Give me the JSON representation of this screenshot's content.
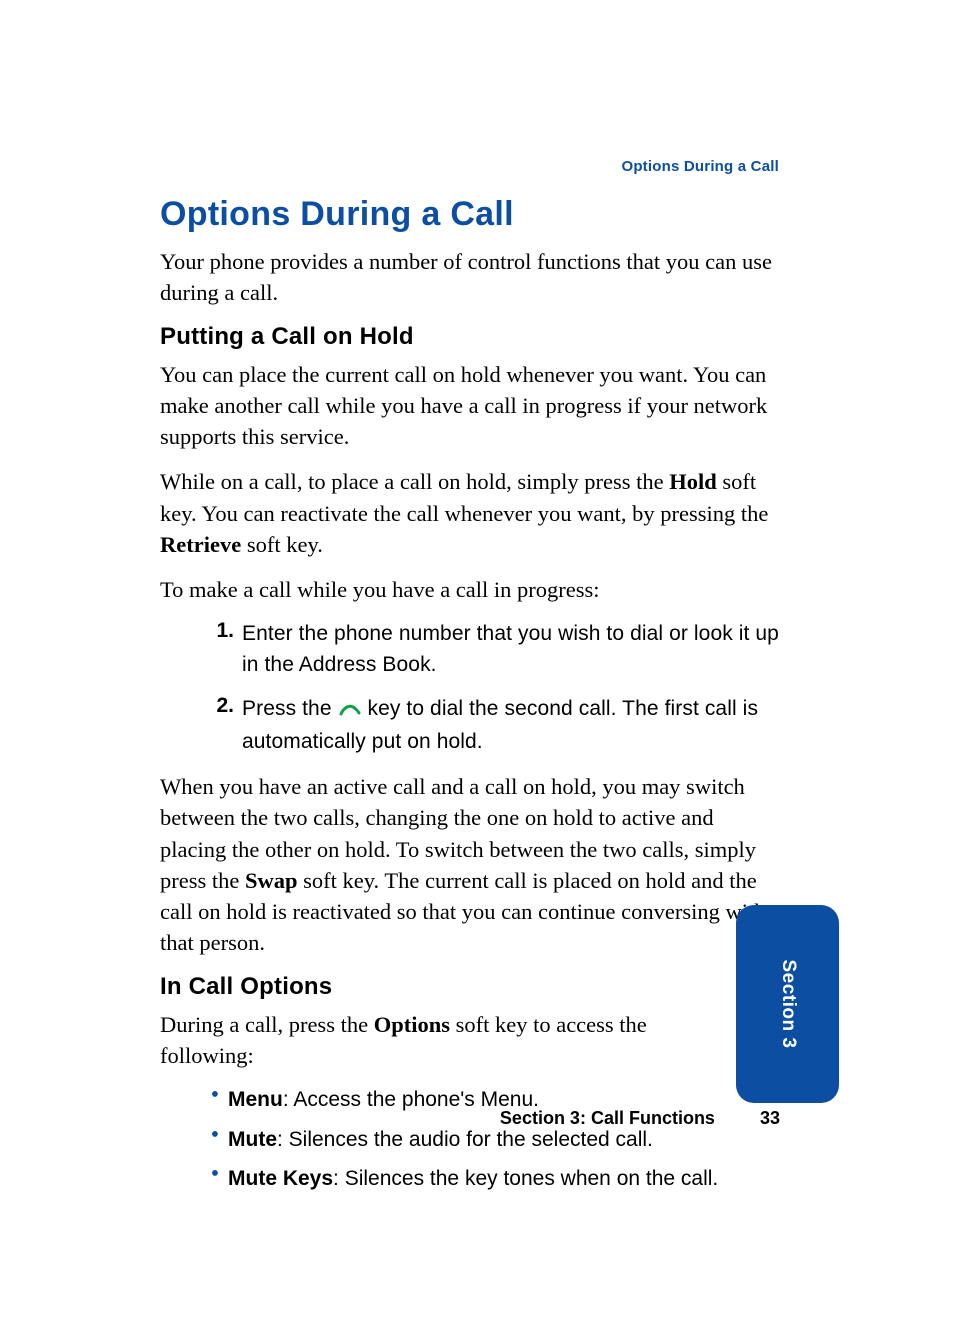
{
  "runningHeader": "Options During a Call",
  "title": "Options During a Call",
  "intro": "Your phone provides a number of control functions that you can use during a call.",
  "hold": {
    "heading": "Putting a Call on Hold",
    "p1": "You can place the current call on hold whenever you want. You can make another call while you have a call in progress if your network supports this service.",
    "p2_a": "While on a call, to place a call on hold, simply press the ",
    "p2_bold1": "Hold",
    "p2_b": " soft key. You can reactivate the call whenever you want, by pressing the ",
    "p2_bold2": "Retrieve",
    "p2_c": " soft key.",
    "p3": "To make a call while you have a call in progress:",
    "steps": [
      {
        "num": "1.",
        "text": "Enter the phone number that you wish to dial or look it up in the Address Book."
      },
      {
        "num": "2.",
        "text_a": "Press the ",
        "text_b": " key to dial the second call. The first call is automatically put on hold."
      }
    ],
    "p4_a": "When you have an active call and a call on hold, you may switch between the two calls, changing the one on hold to active and placing the other on hold. To switch between the two calls, simply press the ",
    "p4_bold": "Swap",
    "p4_b": " soft key. The current call is placed on hold and the call on hold is reactivated so that you can continue conversing with that person."
  },
  "options": {
    "heading": "In Call Options",
    "p1_a": "During a call, press the ",
    "p1_bold": "Options",
    "p1_b": " soft key to access the following:",
    "bullets": [
      {
        "term": "Menu",
        "desc": ": Access the phone's Menu."
      },
      {
        "term": "Mute",
        "desc": ": Silences the audio for the selected call."
      },
      {
        "term": "Mute Keys",
        "desc": ": Silences the key tones when on the call."
      }
    ]
  },
  "tabLabel": "Section 3",
  "footer": {
    "section": "Section 3: Call Functions",
    "page": "33"
  }
}
